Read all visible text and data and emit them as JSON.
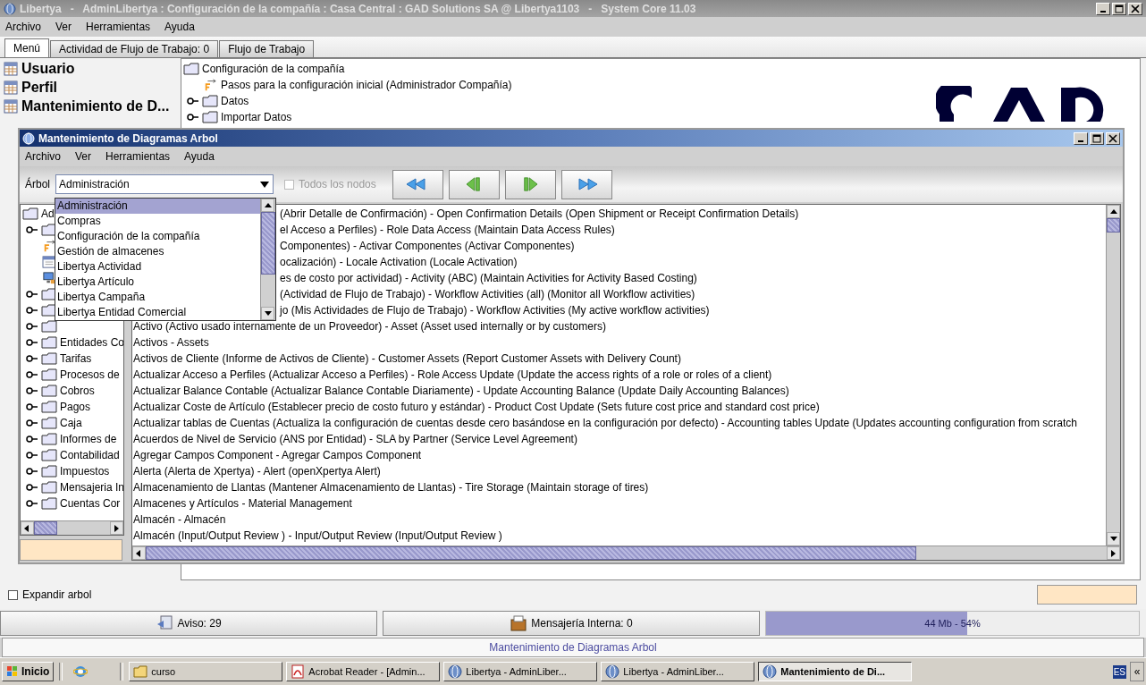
{
  "window": {
    "title": "Libertya   -   AdminLibertya : Configuración de la compañía : Casa Central : GAD Solutions SA @ Libertya1103   -   System Core 11.03"
  },
  "menu": [
    "Archivo",
    "Ver",
    "Herramientas",
    "Ayuda"
  ],
  "tabs": [
    {
      "label": "Menú",
      "selected": true
    },
    {
      "label": "Actividad de Flujo de Trabajo: 0",
      "selected": false
    },
    {
      "label": "Flujo de Trabajo",
      "selected": false
    }
  ],
  "shortcuts": [
    "Usuario",
    "Perfil",
    "Mantenimiento de D..."
  ],
  "menu_tree": {
    "label": "Configuración de la compañía",
    "children": [
      {
        "label": "Pasos para la configuración inicial (Administrador Compañía)",
        "kind": "process"
      },
      {
        "label": "Datos",
        "kind": "folder"
      },
      {
        "label": "Importar Datos",
        "kind": "folder"
      }
    ]
  },
  "expand_tree": {
    "label": "Expandir arbol",
    "checked": false
  },
  "status": {
    "notices": "Aviso: 29",
    "messages": "Mensajería Interna: 0",
    "memory": {
      "reading": "44 Mb - 54%",
      "level": 0.54
    },
    "line": "Mantenimiento de Diagramas Arbol"
  },
  "dialog": {
    "title": "Mantenimiento de Diagramas Arbol",
    "menu": [
      "Archivo",
      "Ver",
      "Herramientas",
      "Ayuda"
    ],
    "tree_label": "Árbol",
    "tree_value": "Administración",
    "all_nodes": {
      "label": "Todos los nodos",
      "checked": false,
      "disabled": true
    },
    "dropdown": [
      {
        "label": "Administración",
        "selected": true
      },
      {
        "label": "Compras",
        "selected": false
      },
      {
        "label": "Configuración de la compañía",
        "selected": false
      },
      {
        "label": "Gestión de almacenes",
        "selected": false
      },
      {
        "label": "Libertya Actividad",
        "selected": false
      },
      {
        "label": "Libertya Artículo",
        "selected": false
      },
      {
        "label": "Libertya Campaña",
        "selected": false
      },
      {
        "label": "Libertya Entidad Comercial",
        "selected": false
      }
    ],
    "tree": {
      "label": "Ad",
      "children": [
        {
          "kind": "folder",
          "expandable": true
        },
        {
          "kind": "process",
          "expandable": false
        },
        {
          "kind": "window",
          "expandable": false
        },
        {
          "kind": "report",
          "expandable": false
        },
        {
          "kind": "folder",
          "expandable": true
        },
        {
          "kind": "folder",
          "expandable": true
        },
        {
          "kind": "folder",
          "expandable": true
        },
        {
          "label": "Entidades Co",
          "kind": "folder",
          "expandable": true
        },
        {
          "label": "Tarifas",
          "kind": "folder",
          "expandable": true
        },
        {
          "label": "Procesos de",
          "kind": "folder",
          "expandable": true
        },
        {
          "label": "Cobros",
          "kind": "folder",
          "expandable": true
        },
        {
          "label": "Pagos",
          "kind": "folder",
          "expandable": true
        },
        {
          "label": "Caja",
          "kind": "folder",
          "expandable": true
        },
        {
          "label": "Informes de",
          "kind": "folder",
          "expandable": true
        },
        {
          "label": "Contabilidad",
          "kind": "folder",
          "expandable": true
        },
        {
          "label": "Impuestos",
          "kind": "folder",
          "expandable": true
        },
        {
          "label": "Mensajeria In",
          "kind": "folder",
          "expandable": true
        },
        {
          "label": "Cuentas Cor",
          "kind": "folder",
          "expandable": true
        }
      ]
    },
    "list": [
      {
        "kind": "partial",
        "text": "(Abrir Detalle de Confirmación) - Open Confirmation Details (Open Shipment or Receipt Confirmation Details)"
      },
      {
        "kind": "partial",
        "text": "el Acceso a Perfiles) - Role Data Access (Maintain Data Access Rules)"
      },
      {
        "kind": "partial",
        "text": "Componentes) - Activar Componentes (Activar Componentes)"
      },
      {
        "kind": "partial",
        "text": "ocalización) - Locale Activation (Locale Activation)"
      },
      {
        "kind": "partial",
        "text": "es de costo por actividad) - Activity (ABC) (Maintain Activities for Activity Based Costing)"
      },
      {
        "kind": "partial",
        "text": "(Actividad de Flujo de Trabajo) - Workflow Activities (all) (Monitor all Workflow activities)"
      },
      {
        "kind": "partial",
        "text": "jo (Mis Actividades de Flujo de Trabajo) - Workflow Activities (My active workflow activities)"
      },
      {
        "kind": "full",
        "text": "Activo (Activo usado internamente de un Proveedor) - Asset (Asset used internally or by customers)"
      },
      {
        "kind": "full",
        "text": "Activos - Assets"
      },
      {
        "kind": "full",
        "text": "Activos de Cliente (Informe de Activos de Cliente) - Customer Assets (Report Customer Assets with Delivery Count)"
      },
      {
        "kind": "full",
        "text": "Actualizar Acceso a Perfiles (Actualizar Acceso a Perfiles) - Role Access Update (Update the access rights of a role or roles of a client)"
      },
      {
        "kind": "full",
        "text": "Actualizar Balance Contable (Actualizar Balance Contable Diariamente) - Update Accounting Balance (Update Daily Accounting Balances)"
      },
      {
        "kind": "full",
        "text": "Actualizar Coste de Artículo (Establecer precio de costo futuro y estándar) - Product Cost Update (Sets future cost price and standard cost price)"
      },
      {
        "kind": "full",
        "text": "Actualizar tablas de Cuentas (Actualiza la configuración de cuentas desde cero basándose en la configuración por defecto) - Accounting tables Update (Updates accounting configuration from scratch"
      },
      {
        "kind": "full",
        "text": "Acuerdos de Nivel de Servicio (ANS por Entidad) - SLA by Partner (Service Level Agreement)"
      },
      {
        "kind": "full",
        "text": "Agregar Campos Component - Agregar Campos Component"
      },
      {
        "kind": "full",
        "text": "Alerta (Alerta de Xpertya) - Alert (openXpertya Alert)"
      },
      {
        "kind": "full",
        "text": "Almacenamiento de Llantas (Mantener Almacenamiento de Llantas) - Tire Storage (Maintain storage of tires)"
      },
      {
        "kind": "full",
        "text": "Almacenes y Artículos - Material Management"
      },
      {
        "kind": "full",
        "text": "Almacén - Almacén"
      },
      {
        "kind": "full",
        "text": "Almacén (Input/Output Review ) - Input/Output Review  (Input/Output Review )"
      }
    ]
  },
  "taskbar": {
    "start": "Inicio",
    "tasks": [
      {
        "label": "curso",
        "kind": "folder",
        "selected": false
      },
      {
        "label": "Acrobat Reader - [Admin...",
        "kind": "pdf",
        "selected": false
      },
      {
        "label": "Libertya - AdminLiber...",
        "kind": "app",
        "selected": false
      },
      {
        "label": "Libertya - AdminLiber...",
        "kind": "app",
        "selected": false
      },
      {
        "label": "Mantenimiento de Di...",
        "kind": "app",
        "selected": true
      }
    ],
    "language": "ES",
    "tray_toggle": "«"
  }
}
